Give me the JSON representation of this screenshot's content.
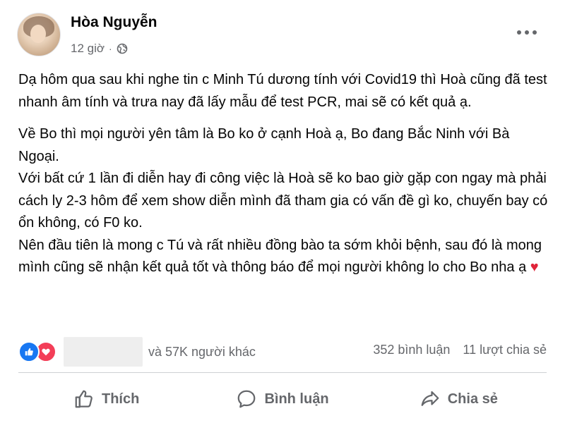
{
  "post": {
    "author": "Hòa Nguyễn",
    "time": "12 giờ",
    "separator": "·",
    "privacy_icon": "globe-icon",
    "more_icon": "more-options-icon",
    "paragraphs": [
      "Dạ hôm qua sau khi nghe tin c Minh Tú dương tính với Covid19 thì Hoà cũng đã test nhanh âm tính và trưa nay đã lấy mẫu để test PCR, mai sẽ có kết quả ạ.",
      "Về Bo thì mọi người yên tâm là Bo ko ở cạnh Hoà ạ, Bo đang Bắc Ninh với Bà Ngoại.",
      "Với bất cứ 1 lần đi diễn hay đi công việc là Hoà sẽ ko bao giờ gặp con ngay mà phải cách ly 2-3 hôm để xem show diễn mình đã tham gia có vấn đề gì ko, chuyến bay có ổn không, có F0 ko.",
      "Nên đầu tiên là mong c Tú và rất nhiều đồng bào ta sớm khỏi bệnh, sau đó là mong mình cũng sẽ nhận kết quả tốt và thông báo để mọi người không lo cho Bo nha ạ"
    ],
    "heart_emoji": "♥"
  },
  "reactions": {
    "icons": [
      "like-reaction-icon",
      "love-reaction-icon"
    ],
    "others_text": "và 57K người khác",
    "comments": "352 bình luận",
    "shares": "11 lượt chia sẻ"
  },
  "actions": {
    "like": "Thích",
    "comment": "Bình luận",
    "share": "Chia sẻ"
  },
  "colors": {
    "like_blue": "#1877f2",
    "love_red": "#f33e58",
    "secondary_text": "#65676b"
  }
}
